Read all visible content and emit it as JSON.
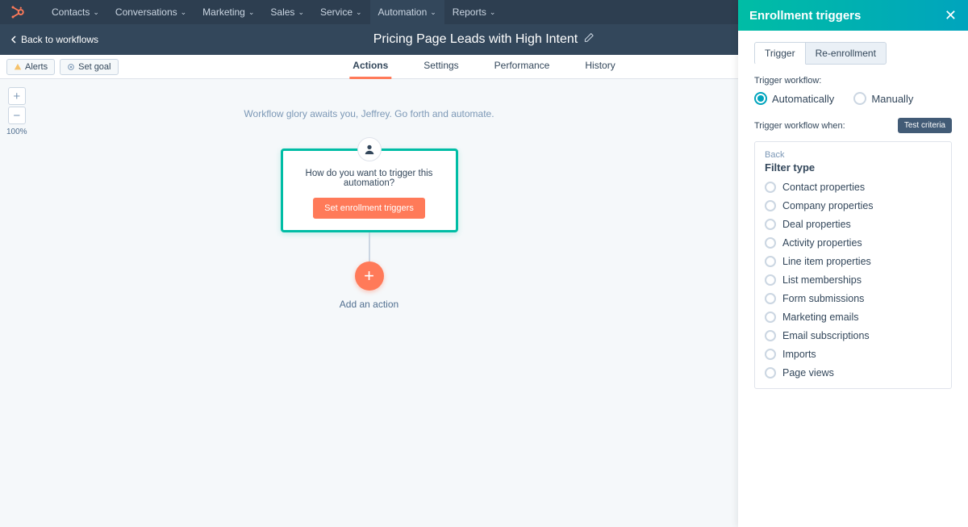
{
  "nav": {
    "items": [
      "Contacts",
      "Conversations",
      "Marketing",
      "Sales",
      "Service",
      "Automation",
      "Reports"
    ],
    "active_index": 5
  },
  "header": {
    "back_label": "Back to workflows",
    "workflow_title": "Pricing Page Leads with High Intent"
  },
  "toolbar": {
    "alerts_label": "Alerts",
    "set_goal_label": "Set goal"
  },
  "tabs": {
    "items": [
      "Actions",
      "Settings",
      "Performance",
      "History"
    ],
    "active_index": 0
  },
  "zoom": {
    "level_label": "100%"
  },
  "canvas": {
    "greeting": "Workflow glory awaits you, Jeffrey. Go forth and automate.",
    "card_question": "How do you want to trigger this automation?",
    "set_triggers_label": "Set enrollment triggers",
    "add_action_label": "Add an action"
  },
  "panel": {
    "title": "Enrollment triggers",
    "subtabs": [
      "Trigger",
      "Re-enrollment"
    ],
    "subtab_active": 0,
    "trigger_workflow_label": "Trigger workflow:",
    "mode_options": [
      "Automatically",
      "Manually"
    ],
    "mode_selected": 0,
    "when_label": "Trigger workflow when:",
    "test_criteria_label": "Test criteria",
    "filter_back_label": "Back",
    "filter_type_label": "Filter type",
    "filter_types": [
      "Contact properties",
      "Company properties",
      "Deal properties",
      "Activity properties",
      "Line item properties",
      "List memberships",
      "Form submissions",
      "Marketing emails",
      "Email subscriptions",
      "Imports",
      "Page views"
    ]
  }
}
